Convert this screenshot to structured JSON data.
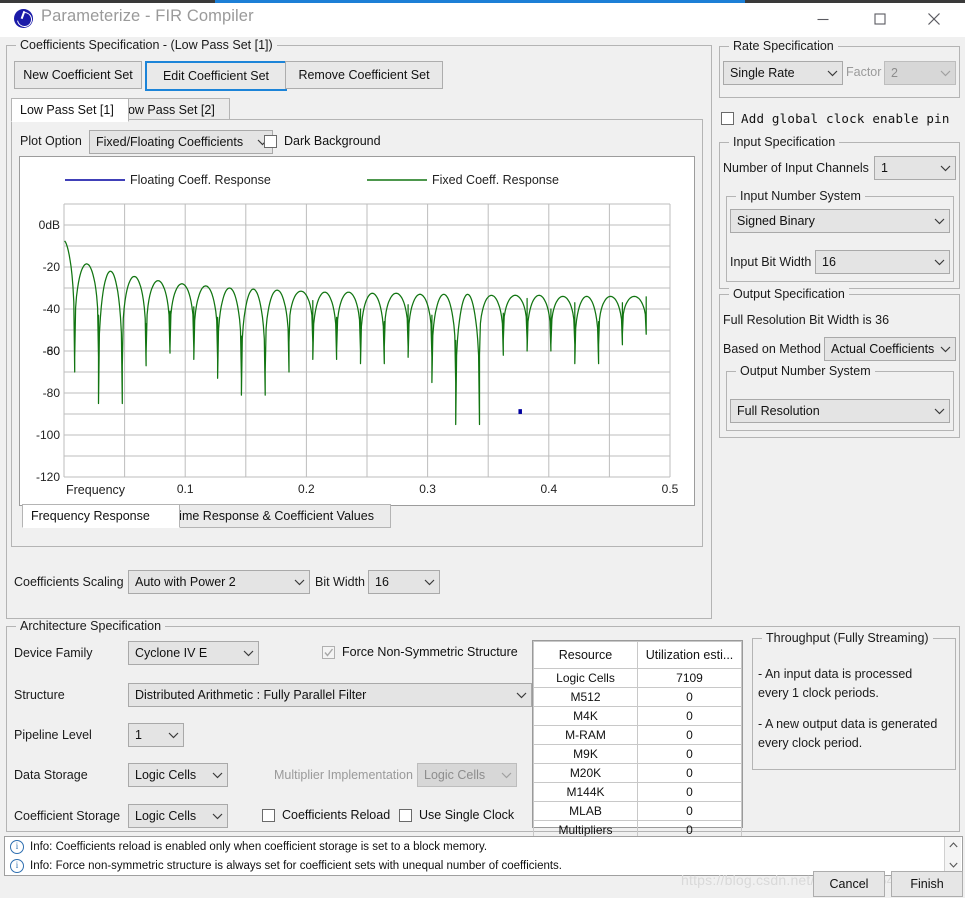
{
  "window": {
    "title": "Parameterize - FIR Compiler",
    "icon": "app-logo-icon",
    "controls": {
      "minimize": "minimize-icon",
      "maximize": "maximize-icon",
      "close": "close-icon"
    }
  },
  "coefficients_specification": {
    "title": "Coefficients Specification - (Low Pass Set [1])",
    "buttons": [
      {
        "label": "New Coefficient Set",
        "selected": false
      },
      {
        "label": "Edit Coefficient Set",
        "selected": true
      },
      {
        "label": "Remove Coefficient Set",
        "selected": false
      }
    ],
    "set_tabs": [
      {
        "label": "Low Pass Set [1]",
        "active": true
      },
      {
        "label": "Low Pass Set [2]",
        "active": false
      }
    ],
    "plot_option_label": "Plot Option",
    "plot_option_value": "Fixed/Floating Coefficients",
    "dark_background_label": "Dark Background",
    "dark_background_checked": false,
    "response_tabs": [
      {
        "label": "Frequency Response",
        "active": true
      },
      {
        "label": "Time Response & Coefficient Values",
        "active": false
      }
    ],
    "coefficients_scaling_label": "Coefficients Scaling",
    "coefficients_scaling_value": "Auto with Power 2",
    "bit_width_label": "Bit Width",
    "bit_width_value": "16"
  },
  "chart_data": {
    "type": "line",
    "title": "",
    "xlabel": "Frequency",
    "ylabel": "",
    "xlim": [
      0,
      0.5
    ],
    "ylim": [
      -120,
      0
    ],
    "grid": true,
    "x_ticks": [
      "0.1",
      "0.2",
      "0.3",
      "0.4",
      "0.5"
    ],
    "x_tick_values": [
      0.1,
      0.2,
      0.3,
      0.4,
      0.5
    ],
    "y_ticks": [
      "0dB",
      "-20",
      "-40",
      "-60",
      "-80",
      "-100",
      "-120"
    ],
    "y_tick_values": [
      0,
      -20,
      -40,
      -60,
      -80,
      -100,
      -120
    ],
    "legend_position": "top",
    "series": [
      {
        "name": "Floating Coeff. Response",
        "color": "#0000a0"
      },
      {
        "name": "Fixed Coeff. Response",
        "color": "#127512"
      }
    ],
    "lobe_peaks_db": [
      -7,
      -18.5,
      -22,
      -24.5,
      -26.5,
      -28,
      -29,
      -30,
      -30.5,
      -31,
      -31.5,
      -32,
      -32,
      -32.5,
      -32.5,
      -33,
      -33,
      -33,
      -33.5,
      -33.5,
      -33.5,
      -34,
      -34,
      -34,
      -34
    ],
    "null_depths_db": [
      -70,
      -63,
      -85,
      -67,
      -61,
      -59,
      -64,
      -73,
      -81,
      -70,
      -56,
      -64,
      -60,
      -66,
      -58,
      -63,
      -75,
      -95,
      -62,
      -55,
      -60,
      -57,
      -66,
      -57,
      -52
    ],
    "notes": "Lowpass FIR magnitude response; main lobe peak about -7 dB near f=0.018, repeating sidelobe nulls to f=0.5"
  },
  "rate_specification": {
    "title": "Rate Specification",
    "rate_value": "Single Rate",
    "factor_label": "Factor",
    "factor_value": "2",
    "factor_disabled": true
  },
  "global_clock": {
    "label": "Add global clock enable pin",
    "checked": false
  },
  "input_specification": {
    "title": "Input Specification",
    "channels_label": "Number of Input Channels",
    "channels_value": "1",
    "number_system_title": "Input Number System",
    "number_system_value": "Signed Binary",
    "bit_width_label": "Input Bit Width",
    "bit_width_value": "16"
  },
  "output_specification": {
    "title": "Output Specification",
    "full_resolution_text": "Full Resolution Bit Width is 36",
    "based_on_method_label": "Based on Method",
    "based_on_method_value": "Actual Coefficients",
    "number_system_title": "Output Number System",
    "number_system_value": "Full Resolution"
  },
  "architecture_specification": {
    "title": "Architecture Specification",
    "device_family_label": "Device Family",
    "device_family_value": "Cyclone IV E",
    "force_non_symmetric_label": "Force Non-Symmetric Structure",
    "force_non_symmetric_checked": true,
    "force_non_symmetric_disabled": true,
    "structure_label": "Structure",
    "structure_value": "Distributed Arithmetic : Fully Parallel Filter",
    "pipeline_level_label": "Pipeline Level",
    "pipeline_level_value": "1",
    "data_storage_label": "Data Storage",
    "data_storage_value": "Logic Cells",
    "multiplier_implementation_label": "Multiplier Implementation",
    "multiplier_implementation_value": "Logic Cells",
    "multiplier_implementation_disabled": true,
    "coefficient_storage_label": "Coefficient Storage",
    "coefficient_storage_value": "Logic Cells",
    "coefficients_reload_label": "Coefficients Reload",
    "coefficients_reload_checked": false,
    "use_single_clock_label": "Use Single Clock",
    "use_single_clock_checked": false
  },
  "resource_table": {
    "headers": [
      "Resource",
      "Utilization esti..."
    ],
    "rows": [
      [
        "Logic Cells",
        "7109"
      ],
      [
        "M512",
        "0"
      ],
      [
        "M4K",
        "0"
      ],
      [
        "M-RAM",
        "0"
      ],
      [
        "M9K",
        "0"
      ],
      [
        "M20K",
        "0"
      ],
      [
        "M144K",
        "0"
      ],
      [
        "MLAB",
        "0"
      ],
      [
        "Multipliers",
        "0"
      ]
    ]
  },
  "throughput": {
    "title": "Throughput (Fully Streaming)",
    "lines": [
      "- An input data is processed",
      "every 1 clock periods.",
      "",
      "- A new output data is generated",
      "every clock period."
    ]
  },
  "messages": [
    "Info: Coefficients reload is enabled only when coefficient storage is set to a block memory.",
    "Info: Force non-symmetric structure is always set for coefficient sets with unequal number of coefficients."
  ],
  "footer": {
    "cancel_label": "Cancel",
    "finish_label": "Finish",
    "watermark": "https://blog.csdn.net/weixin_41542512"
  }
}
